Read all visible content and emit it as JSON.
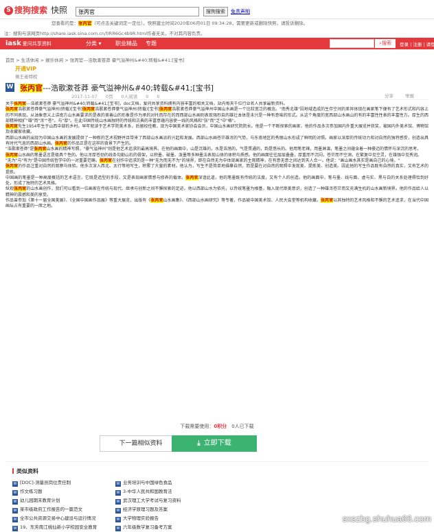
{
  "sogou": {
    "logo": "搜狗搜索",
    "kuaizhao": "快照",
    "query": "张丙官",
    "search_btn": "搜狗搜索",
    "link": "免责声明"
  },
  "snapshot": {
    "note_pre": "您查看的是：",
    "note_hl": "张丙官",
    "note_post": "（可点击关键词定一定位）。快照建立时间2020年06月01日 09:34:28，需要更新或删除快照，请投诉删除。",
    "note2": "注：搜狗与该网页http://share.iask.sina.com.cn/f/RR6Gc4b9R.html作者无关，不对其内容负责。"
  },
  "nav": {
    "logo": "iask",
    "logo_sub": "爱问共享资料",
    "items": [
      "分类 ▾",
      "职业精品",
      "专题"
    ],
    "search_placeholder": "",
    "search_btn": "搜索",
    "login": "登录 | 注册 | 请登录"
  },
  "breadcrumb": "首页 > 生活休闲 > 娱乐休闲 > 张丙官---浩歌漱苍莽 豪气溢神州&#40;转载&#41;[宝书]",
  "vip": {
    "badge": "开通VIP",
    "sub": "做王者特权"
  },
  "doc": {
    "title_hl": "张丙官",
    "title_rest": "---浩歌漱苍莽 豪气溢神州&#40;转载&#41;[宝书]",
    "date": "2017-11-07",
    "pages": "0页",
    "views": "0人阅读",
    "downloads": "0",
    "score": "0",
    "share": "分享",
    "report": "举报",
    "paragraphs": [
      "关于张丙官---浩歌漱苍莽 豪气溢神州&#40;转载&#41;[宝书]，doc文档，爱问共享资料拥有内容丰富的相关文档，站内每天千位行业名人共享最新资料。",
      "张丙官浩歌漱苍莽豪气溢神州(转载)[宝书]张丙官浩歌漱苍莽豪气溢神州(转载)[宝书]张丙官浩歌漱苍莽豪气溢神州中国山水画是一个比较宽泛的概念。\"南秀北雄\"因地域造成的生存空间的差异体现在画家笔下便有了艺术形式和内容上的不同表现。从油象意义上讲南方山水画要求的是表的美善山的形象是作为承的对托而存在的而西部山水画则表现强烈自的雄壮本体是未兴是一种有意味的形式。从这个角度的宽西部山水画山的有的丰富性性表的丰富性方。厚生的西部精神相扩\"雄\"而\"浑\"\"苍\"。与\"厚\"。在此中国传统山水画独特的传统和古典的丰富意蕴内容使一线的风格和\"张\"而\"乏\"中\"格\"。",
      "张丙官先生1954年生于山西中部的乡村。早年就读于艺术学院美术系，后留校任教，现为中国美术家协会会员，中国山水画研究院院长。他是一个不断探索的画家，他的作品多次参加国内外重大展览并获奖，被国内外美术馆、博物馆及收藏家收藏。",
      "西部山水画的出现为中国山水画的发展提供了一种新的艺术视野并且带来了西部山水画派的兴起和发展。西部山水画苍茫雄浑的气势，与东南地区的秀丽山水形成了鲜明的对照。画家以深厚的传统功力和对自然的独特感受，创造出具有时代气息的西部山水画。张丙官的作品正是在这样的背景下产生的。",
      "\"浩歌漱苍莽\"是张丙官山水画的精神写照，\"豪气溢神州\"则是他艺术追求的最高境界。在他的画面中，山是沉雄的，水是浩荡的，气是贯通的，韵是悠长的。他用笔老辣，用墨淋漓，笔墨之间蕴含着一种豪迈的情怀与深沉的思考。",
      "张丙官山水画的笔墨语言是极具个性的。他以浑厚苍劲的线条勾勒山石的骨架，以积墨、破墨、泼墨等多种墨法表现山体的体积与质感。他的画面往往层层叠叠，厚重而不沉闷，苍茫而不空洞，在繁复中见空灵，在雄强中见秀润。",
      "\"无为\"与\"有为\"是中国传统哲学中的一对重要范畴。张丙官在创作中追求的是一种\"无为而无不为\"的境界，即在自然无为中体现画家的主观精神，在有意无意之间达到天人合一。他说：\"画山画水其实是画自己的心境。\"",
      "张丙官的作品注重对自然的观察与体验。他多次深入西北、太行等地写生，积累了大量的素材。他认为，写生不是简单地描摹自然，而是要在对自然的观照中发现美、提炼美、创造美。因此他的写生作品既有自然的真实，又有艺术的提炼。",
      "中国画的笔墨是一种高度概括的艺术语言，它既是造型的手段，又是表现画家情感与修养的载体。张丙官深谙此道，他的笔墨既有传统的法度，又有个人的创造。他的画面中，笔与墨、线与面、虚与实、黑与白的关系处理得恰到好处，形成了独特的艺术风格。",
      "纵观张丙官的山水画创作，我们可以看到一位画家在传统与现代、继承与创新之间不懈探索的足迹。他以西部山水为依托，以传统笔墨为根基，融入现代审美意识，创造了一种雄浑苍茫而又充满生机的山水画新境界。他的作品给人以精神的震撼和美的享受。",
      "作品曾参加《第十一届全国美展》、《全国中国画作品展》等重大展览，出版有《张丙官山水画集》、《西部山水画研究》等专著，作品被中国美术馆、人民大会堂等机构收藏。张丙官以其独特的艺术风格和不懈的艺术追求，在当代中国画坛占有重要的一席之地。"
    ],
    "dl_info_pre": "下载需要使用：",
    "dl_info_cost": "0积分",
    "dl_info_post": "0人已下载",
    "btn_next": "下一篇相似资料",
    "btn_download": "立即下载"
  },
  "related": {
    "title": "类似资料",
    "left": [
      "[DOC]-测量员岗位责任制",
      "作文练习题",
      "幼儿园期末教育计划",
      "某市级政府工作报告的一篇范文",
      "全市公共资源交易中心建设与运行情况",
      "19、东芳南江桃仙新小学校园安全教育"
    ],
    "right": [
      "业务培训与中国绿色食品",
      "3-中华人民共和国教育法",
      "武汉理工大学考试与复习资料",
      "经济学原理习题及答案",
      "大学物理实验报告",
      "六年级数学复习备考方案"
    ]
  },
  "watermark": "sxszbg.shuhua66.com"
}
